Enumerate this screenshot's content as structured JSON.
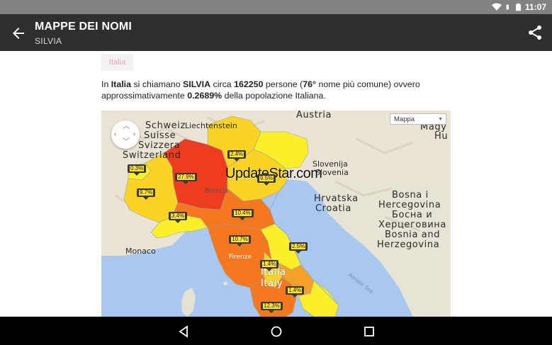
{
  "status_bar": {
    "time": "11:07",
    "icons": [
      "wifi-icon",
      "sim-icon",
      "battery-icon"
    ]
  },
  "app_bar": {
    "title": "MAPPE DEI NOMI",
    "subtitle": "SILVIA",
    "back_icon": "arrow-back-icon",
    "share_icon": "share-icon"
  },
  "chip": {
    "label": "Italia"
  },
  "description": {
    "p1": "In ",
    "country": "Italia",
    "p2": " si chiamano ",
    "name": "SILVIA",
    "p3": " circa ",
    "count": "162250",
    "p4": " persone (",
    "rank": "76°",
    "p5": " nome più comune) ovvero approssimativamente ",
    "percent": "0.2689%",
    "p6": " della popolazione Italiana."
  },
  "map": {
    "type_selector": "Mappa",
    "watermark": "UpdateStar.com",
    "place_labels": {
      "schweiz": "Schweiz",
      "suisse": "Suisse",
      "svizzera": "Svizzera",
      "switzerland": "Switzerland",
      "liechtenstein": "Liechtenstein",
      "austria": "Austria",
      "magyar": "Magy",
      "hu": "Hu",
      "slovenija": "Slovenija",
      "slovenia": "Slovenia",
      "hrvatska": "Hrvatska",
      "croatia": "Croatia",
      "bosna": "Bosna i",
      "hercegovina": "Hercegovina",
      "bosna_cyr": "Босна и",
      "herceg_cyr": "Херцеговина",
      "bosnia": "Bosnia and",
      "herzegovina": "Herzegovina",
      "italia": "Italia",
      "italy": "Italy",
      "monaco": "Monaco",
      "brescia": "Brescia",
      "firenze": "Firenze",
      "adriatic": "Adriatic Sea"
    },
    "percent_badges": [
      "0.3%",
      "27.9%",
      "2.4%",
      "9.7%",
      "3.4%",
      "10.4%",
      "10.7%",
      "2.5%",
      "1.4%",
      "1.4%",
      "12.3%",
      "9.5%"
    ],
    "region_colors": {
      "very_high": "#ef3b1f",
      "high": "#f6781e",
      "mid_high": "#f4a12a",
      "mid": "#f9d423",
      "low": "#fbef2a"
    }
  },
  "nav_bar": {
    "back": "nav-back-icon",
    "home": "nav-home-icon",
    "recents": "nav-recents-icon"
  }
}
